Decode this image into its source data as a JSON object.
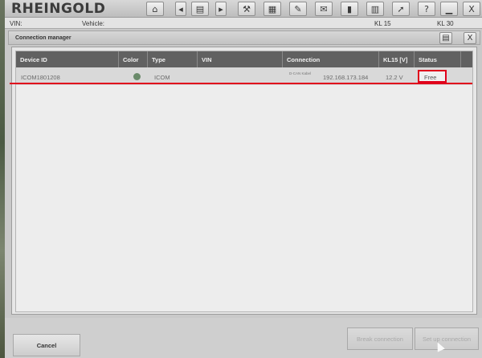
{
  "app": {
    "title": "RHEINGOLD"
  },
  "toolbar": {
    "icons": [
      "home-icon",
      "prev-icon",
      "document-icon",
      "next-icon",
      "wrench-icon",
      "grid-icon",
      "tool-icon",
      "mail-icon",
      "battery-icon",
      "chart-icon",
      "cursor-icon",
      "help-icon",
      "minimize-icon",
      "close-icon"
    ],
    "help_label": "?",
    "close_label": "X"
  },
  "vehicle_bar": {
    "vin_label": "VIN:",
    "vehicle_label": "Vehicle:",
    "kl15_label": "KL 15",
    "kl30_label": "KL 30"
  },
  "dialog": {
    "title": "Connection manager",
    "close_label": "X"
  },
  "table": {
    "columns": [
      "Device ID",
      "Color",
      "Type",
      "VIN",
      "Connection",
      "KL15 [V]",
      "Status"
    ],
    "rows": [
      {
        "device_id": "ICOM1801208",
        "color": "#6a8a6a",
        "type": "ICOM",
        "vin": "",
        "connection_small": "D-CAN Kabel",
        "connection": "192.168.173.184",
        "kl15": "12.2 V",
        "status": "Free"
      }
    ]
  },
  "buttons": {
    "cancel": "Cancel",
    "break_connection": "Break connection",
    "set_up_connection": "Set up connection"
  },
  "colors": {
    "header_bg": "#616161",
    "highlight": "#e0001b"
  }
}
